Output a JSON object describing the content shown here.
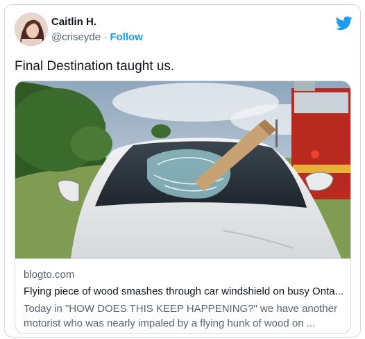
{
  "author": {
    "name": "Caitlin H.",
    "handle": "@criseyde",
    "separator": "·",
    "follow_label": "Follow"
  },
  "tweet": {
    "text": "Final Destination taught us."
  },
  "link_card": {
    "domain": "blogto.com",
    "title": "Flying piece of wood smashes through car windshield on busy Onta...",
    "description": "Today in \"HOW DOES THIS KEEP HAPPENING?\" we have another motorist who was nearly impaled by a flying hunk of wood on ..."
  },
  "icons": {
    "brand": "twitter-bird-icon"
  },
  "colors": {
    "accent": "#1d9bf0",
    "secondary_text": "#536471",
    "border": "#cfd9de"
  }
}
